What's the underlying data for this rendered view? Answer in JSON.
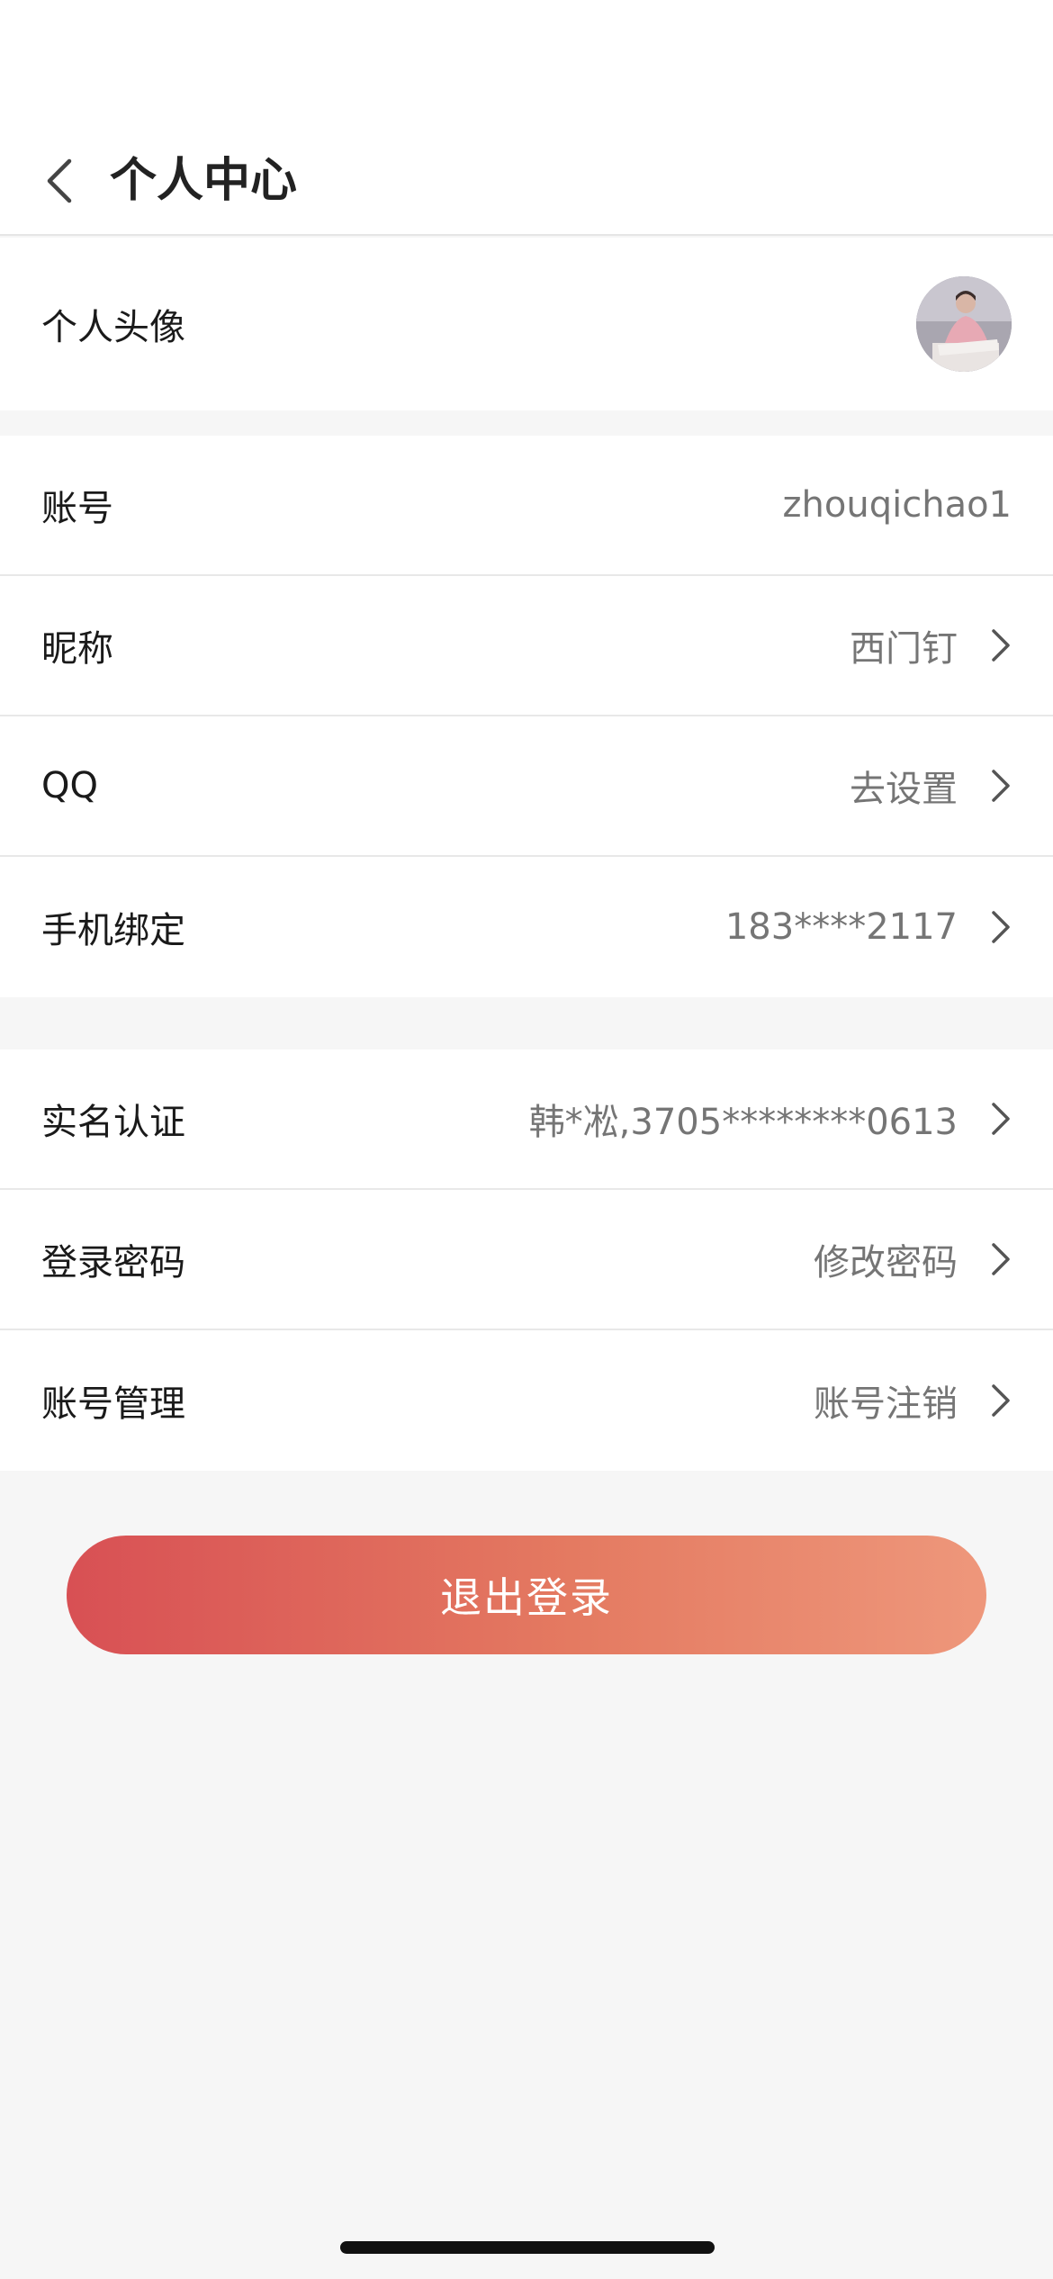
{
  "header": {
    "title": "个人中心",
    "back_icon": "chevron-left-icon"
  },
  "avatar_section": {
    "label": "个人头像"
  },
  "account_group": [
    {
      "name": "row-account",
      "label": "账号",
      "value": "zhouqichao1",
      "has_chevron": false
    },
    {
      "name": "row-nickname",
      "label": "昵称",
      "value": "西门钉",
      "has_chevron": true
    },
    {
      "name": "row-qq",
      "label": "QQ",
      "value": "去设置",
      "has_chevron": true
    },
    {
      "name": "row-phone",
      "label": "手机绑定",
      "value": "183****2117",
      "has_chevron": true
    }
  ],
  "security_group": [
    {
      "name": "row-realname",
      "label": "实名认证",
      "value": "韩*凇,3705********0613",
      "has_chevron": true
    },
    {
      "name": "row-password",
      "label": "登录密码",
      "value": "修改密码",
      "has_chevron": true
    },
    {
      "name": "row-account-manage",
      "label": "账号管理",
      "value": "账号注销",
      "has_chevron": true
    }
  ],
  "logout": {
    "label": "退出登录"
  },
  "colors": {
    "logout_gradient_start": "#d85054",
    "logout_gradient_end": "#ee977b",
    "background": "#f6f6f6",
    "value_text": "#757575"
  }
}
